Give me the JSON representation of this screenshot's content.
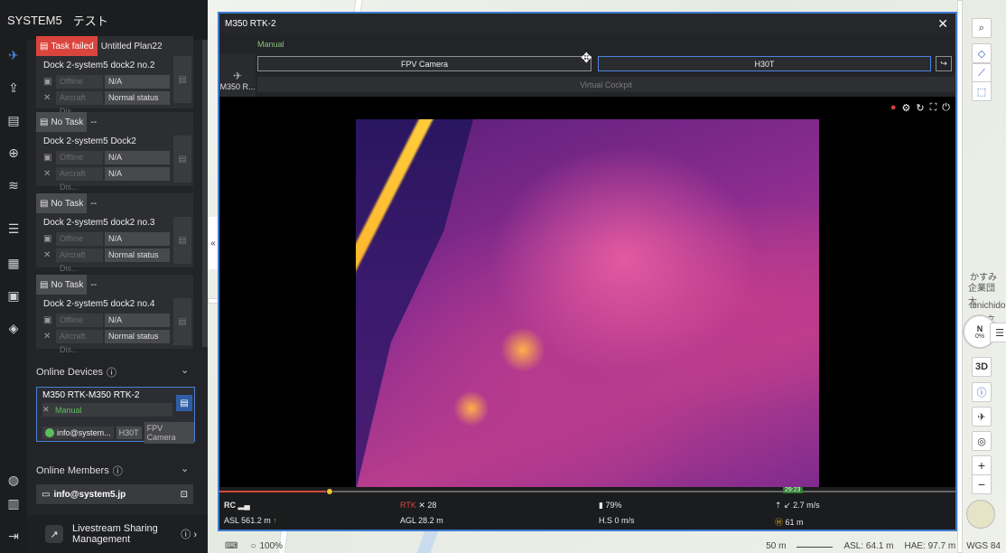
{
  "app": {
    "title": "SYSTEM5",
    "subtitle": "テスト"
  },
  "rail": [
    "drone-icon",
    "upload-icon",
    "layers-icon",
    "globe-pin-icon",
    "waveform-icon",
    "list-icon",
    "calendar-icon",
    "image-icon",
    "cube-icon",
    "globe-icon",
    "document-icon",
    "logout-icon"
  ],
  "task_cards": [
    {
      "status": "Task failed",
      "failed": true,
      "plan": "Untitled Plan22",
      "dock": "Dock 2-system5 dock2 no.2",
      "dock_state": "Offline",
      "dock_value": "N/A",
      "aircraft_state": "Aircraft Dis...",
      "aircraft_value": "Normal status"
    },
    {
      "status": "No Task",
      "failed": false,
      "plan": "--",
      "dock": "Dock 2-system5 Dock2",
      "dock_state": "Offline",
      "dock_value": "N/A",
      "aircraft_state": "Aircraft Dis...",
      "aircraft_value": "N/A"
    },
    {
      "status": "No Task",
      "failed": false,
      "plan": "--",
      "dock": "Dock 2-system5 dock2 no.3",
      "dock_state": "Offline",
      "dock_value": "N/A",
      "aircraft_state": "Aircraft Dis...",
      "aircraft_value": "Normal status"
    },
    {
      "status": "No Task",
      "failed": false,
      "plan": "--",
      "dock": "Dock 2-system5 dock2 no.4",
      "dock_state": "Offline",
      "dock_value": "N/A",
      "aircraft_state": "Aircraft Dis...",
      "aircraft_value": "Normal status"
    }
  ],
  "online_devices": {
    "title": "Online Devices",
    "device": {
      "name": "M350 RTK-M350 RTK-2",
      "mode": "Manual",
      "user": "info@system...",
      "payload1": "H30T",
      "payload2": "FPV Camera"
    }
  },
  "online_members": {
    "title": "Online Members",
    "member": "info@system5.jp"
  },
  "livestream": {
    "line1": "Livestream Sharing",
    "line2": "Management"
  },
  "live_window": {
    "title": "M350 RTK-2",
    "close": "✕",
    "mode": "Manual",
    "drone_label": "M350 R...",
    "camera1": "FPV Camera",
    "camera2": "H30T",
    "virtual_cockpit": "Virtual Cockpit",
    "timeline_time": "29:23",
    "progress": 0.145
  },
  "telemetry": {
    "rc_label": "RC",
    "rtk_label": "RTK",
    "rtk_value": "28",
    "battery": "79%",
    "speed_label": "2.7 m/s",
    "asl": "ASL 561.2 m",
    "agl": "AGL 28.2 m",
    "hs": "H.S 0 m/s",
    "home_dist": "61 m"
  },
  "map": {
    "labels": [
      "かすみ",
      "企業団 大",
      "ainichido",
      "日立"
    ],
    "compass": "N",
    "compass_value": "0%",
    "btn_3d": "3D",
    "btn_plus": "+",
    "btn_minus": "−"
  },
  "statusbar": {
    "zoom": "100%",
    "scale": "50 m",
    "asl": "ASL: 64.1 m",
    "hae": "HAE: 97.7 m",
    "crs": "WGS 84"
  }
}
